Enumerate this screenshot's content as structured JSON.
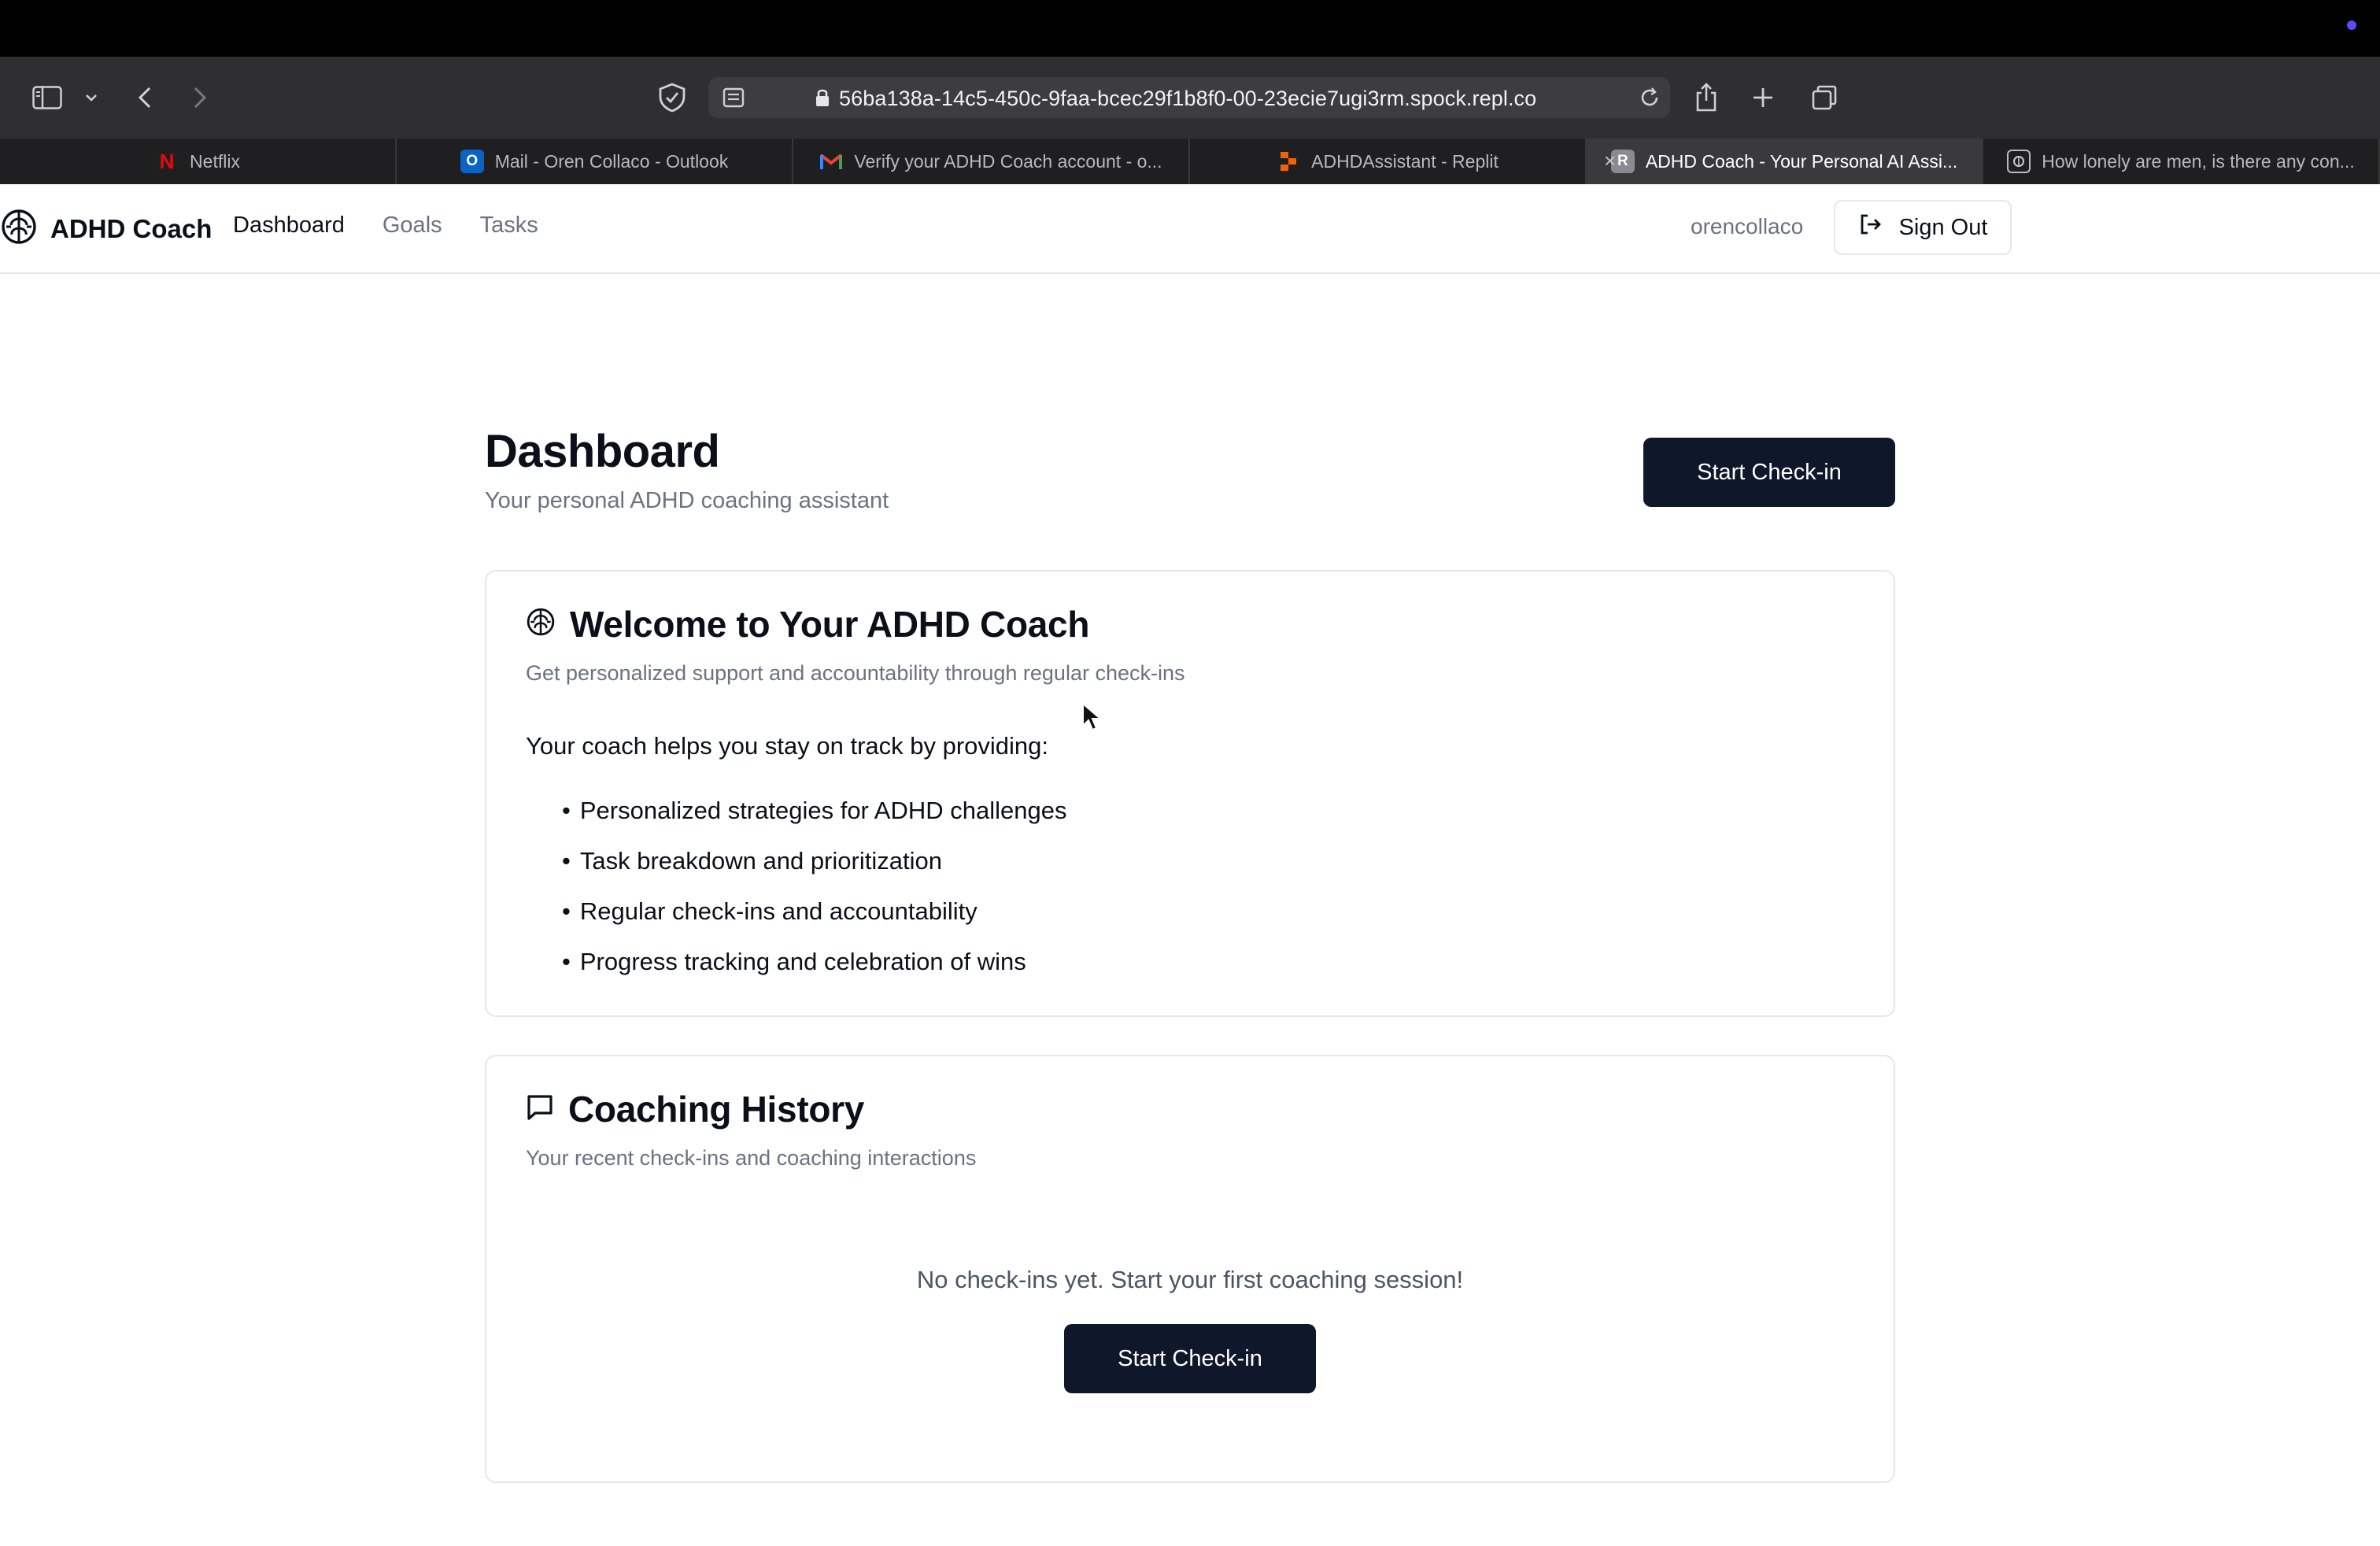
{
  "browser": {
    "url": "56ba138a-14c5-450c-9faa-bcec29f1b8f0-00-23ecie7ugi3rm.spock.repl.co",
    "tabs": [
      {
        "label": "Netflix",
        "favicon": "netflix-icon",
        "active": false
      },
      {
        "label": "Mail - Oren Collaco - Outlook",
        "favicon": "outlook-icon",
        "active": false
      },
      {
        "label": "Verify your ADHD Coach account - o...",
        "favicon": "gmail-icon",
        "active": false
      },
      {
        "label": "ADHDAssistant - Replit",
        "favicon": "replit-icon",
        "active": false
      },
      {
        "label": "ADHD Coach - Your Personal AI Assi...",
        "favicon": "r-letter-icon",
        "active": true
      },
      {
        "label": "How lonely are men, is there any con...",
        "favicon": "site-icon",
        "active": false
      }
    ],
    "active_tab_letter": "R"
  },
  "header": {
    "brand": "ADHD Coach",
    "nav": [
      "Dashboard",
      "Goals",
      "Tasks"
    ],
    "username": "orencollaco",
    "signout_label": "Sign Out"
  },
  "dashboard": {
    "title": "Dashboard",
    "subtitle": "Your personal ADHD coaching assistant",
    "checkin_button": "Start Check-in"
  },
  "welcome_card": {
    "title": "Welcome to Your ADHD Coach",
    "description": "Get personalized support and accountability through regular check-ins",
    "intro": "Your coach helps you stay on track by providing:",
    "features": [
      "Personalized strategies for ADHD challenges",
      "Task breakdown and prioritization",
      "Regular check-ins and accountability",
      "Progress tracking and celebration of wins"
    ]
  },
  "history_card": {
    "title": "Coaching History",
    "description": "Your recent check-ins and coaching interactions",
    "empty_message": "No check-ins yet. Start your first coaching session!",
    "button": "Start Check-in"
  },
  "colors": {
    "primary": "#0f172a",
    "muted_text": "#6b7280",
    "border": "#e5e7eb",
    "browser_toolbar": "#2f2f31",
    "tab_bar": "#1f1f21"
  }
}
